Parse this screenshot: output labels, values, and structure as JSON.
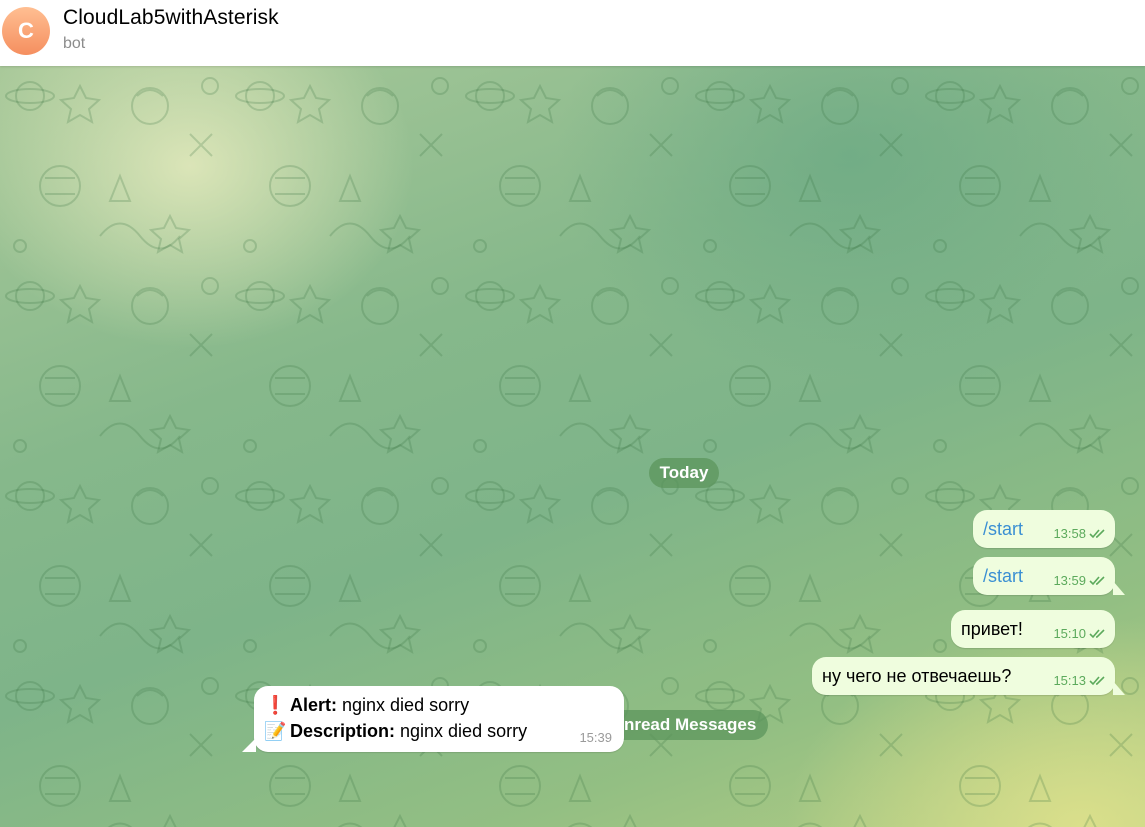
{
  "header": {
    "avatar_letter": "C",
    "title": "CloudLab5withAsterisk",
    "subtitle": "bot"
  },
  "separators": {
    "today": "Today",
    "unread": "Unread Messages"
  },
  "outgoing": [
    {
      "text": "/start",
      "time": "13:58",
      "is_command": true
    },
    {
      "text": "/start",
      "time": "13:59",
      "is_command": true
    },
    {
      "text": "привет!",
      "time": "15:10",
      "is_command": false
    },
    {
      "text": "ну чего не отвечаешь?",
      "time": "15:13",
      "is_command": false
    }
  ],
  "incoming": {
    "line1": {
      "icon": "exclamation-icon",
      "emoji": "❗",
      "label": "Alert:",
      "value": " nginx died sorry"
    },
    "line2": {
      "icon": "memo-icon",
      "emoji": "📝",
      "label": "Description:",
      "value": " nginx died sorry"
    },
    "time": "15:39"
  },
  "colors": {
    "outgoing_bubble": "#effdde",
    "incoming_bubble": "#ffffff",
    "command_link": "#3a8fd3",
    "read_check": "#5caa5c",
    "pill_bg": "#5c965c"
  }
}
